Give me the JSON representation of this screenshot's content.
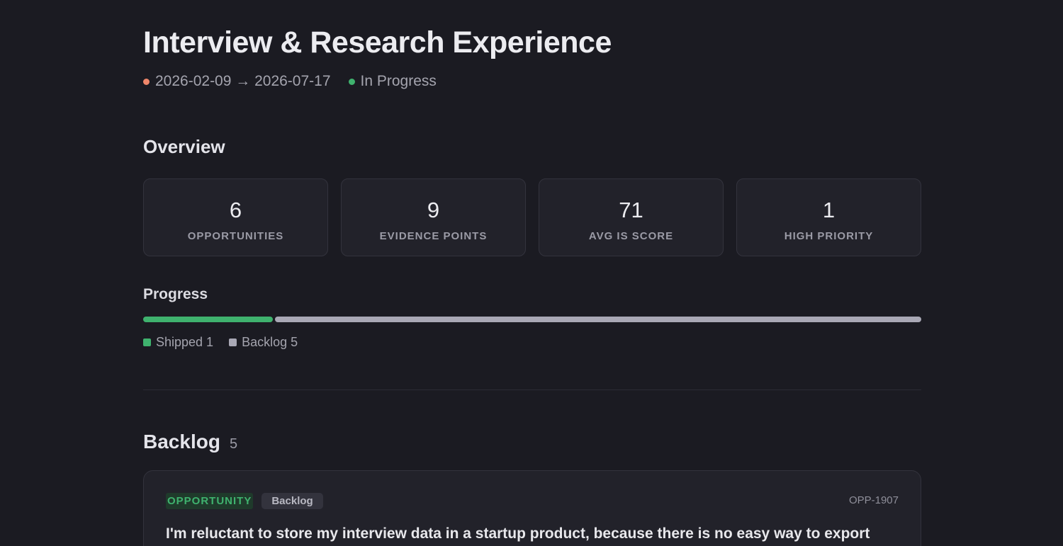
{
  "page": {
    "title": "Interview & Research Experience",
    "date_range": "2026-02-09 → 2026-07-17",
    "status": "In Progress",
    "date_dot_color": "#f0876a",
    "status_dot_color": "#3fb26e"
  },
  "overview": {
    "heading": "Overview",
    "stats": [
      {
        "value": "6",
        "label": "OPPORTUNITIES"
      },
      {
        "value": "9",
        "label": "EVIDENCE POINTS"
      },
      {
        "value": "71",
        "label": "AVG IS SCORE"
      },
      {
        "value": "1",
        "label": "HIGH PRIORITY"
      }
    ]
  },
  "progress": {
    "heading": "Progress",
    "segments": [
      {
        "label": "Shipped",
        "count": 1,
        "text": "Shipped 1",
        "color": "#3fb26e"
      },
      {
        "label": "Backlog",
        "count": 5,
        "text": "Backlog 5",
        "color": "#a9a8b5"
      }
    ]
  },
  "backlog": {
    "heading": "Backlog",
    "count": "5",
    "items": [
      {
        "type": "OPPORTUNITY",
        "status": "Backlog",
        "id": "OPP-1907",
        "text": "I'm reluctant to store my interview data in a startup product, because there is no easy way to export"
      }
    ]
  }
}
